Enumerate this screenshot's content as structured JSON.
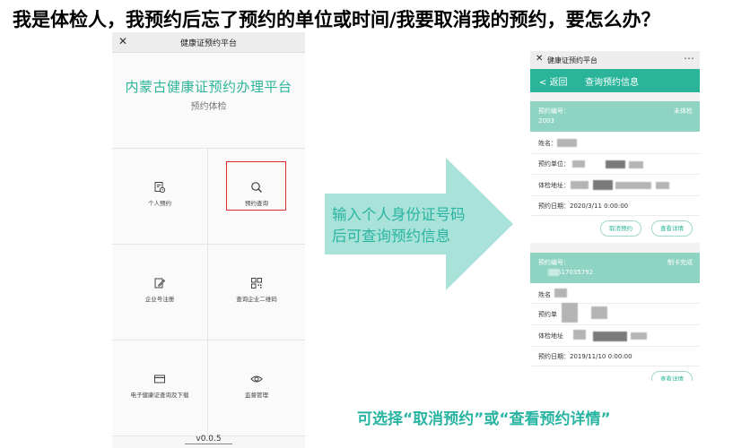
{
  "headline": "我是体检人，我预约后忘了预约的单位或时间/我要取消我的预约，要怎么办？",
  "left_phone": {
    "window_title": "健康证预约平台",
    "platform_title": "内蒙古健康证预约办理平台",
    "subtitle": "预约体检",
    "tiles": [
      {
        "label": "个人预约",
        "icon": "calendar-clock-icon"
      },
      {
        "label": "预约查询",
        "icon": "search-icon",
        "highlighted": true
      },
      {
        "label": "企业号注册",
        "icon": "edit-doc-icon"
      },
      {
        "label": "查询企业二维码",
        "icon": "qr-code-icon"
      },
      {
        "label": "电子健康证查询及下载",
        "icon": "card-icon"
      },
      {
        "label": "监督管理",
        "icon": "eye-icon"
      }
    ],
    "version": "v0.0.5"
  },
  "arrow_text": {
    "line1": "输入个人身份证号码",
    "line2": "后可查询预约信息"
  },
  "right_phone": {
    "window_title": "健康证预约平台",
    "back_label": "返回",
    "nav_title": "查询预约信息",
    "cards": [
      {
        "number_label": "预约编号：",
        "number_value": "2003",
        "status": "未体检",
        "name_label": "姓名：",
        "unit_label": "预约单位：",
        "address_label": "体检地址：",
        "date_label": "预约日期：",
        "date_value": "2020/3/11 0:00:00",
        "cancel_button": "取消预约",
        "detail_button": "查看详情"
      },
      {
        "number_label": "预约编号：",
        "number_value": "517035792",
        "status": "制卡完成",
        "name_label": "姓名",
        "unit_label": "预约单",
        "address_label": "体检地址",
        "date_label": "预约日期：",
        "date_value": "2019/11/10 0:00:00",
        "detail_button": "查看详情"
      }
    ]
  },
  "bottom_caption": "可选择“取消预约”或“查看预约详情”",
  "colors": {
    "accent": "#2ab59a",
    "highlight_border": "#e02b2b",
    "arrow": "#a8e2d8"
  }
}
